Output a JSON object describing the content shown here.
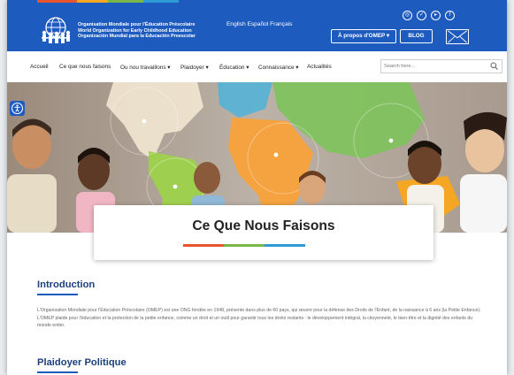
{
  "header": {
    "org_lines": [
      "Organisation Mondiale pour l'Éducation Préscolaire",
      "World Organization for Early Childhood Education",
      "Organización Mundial para la Educación Preescolar"
    ],
    "languages": "English Español Français",
    "about_button": "À propos d'OMEP",
    "blog_button": "BLOG",
    "stripe_colors": [
      "#e8542d",
      "#f5a623",
      "#7ab648",
      "#2e9ad6"
    ]
  },
  "nav": {
    "items": [
      "Accueil",
      "Ce que nous faisons",
      "Ou nou travaillons",
      "Plaidoyer",
      "Éducation",
      "Connaissance",
      "Actualités"
    ],
    "dropdown_mark": "▾",
    "search_placeholder": "Search here..."
  },
  "hero": {
    "title": "Ce Que Nous Faisons",
    "title_bar_colors": [
      "#e8542d",
      "#7ab648",
      "#2e9ad6"
    ]
  },
  "content": {
    "intro_heading": "Introduction",
    "intro_text": "L'Organisation Mondiale pour l'Éducation Préscolaire (OMEP) est une ONG fondée en 1948, présente dans plus de 60 pays, qui œuvre pour la défense des Droits de l'Enfant, de la naissance à 6 ans (la Petite Enfance). L'OMEP plaide pour l'éducation et la protection de la petite enfance, comme un droit et un outil pour garantir tous les droits restants : le développement intégral, la citoyenneté, le bien-être et la dignité des enfants du monde entier.",
    "advocacy_heading": "Plaidoyer Politique"
  },
  "colors": {
    "primary_blue": "#1e5bbf",
    "heading_blue": "#1d3f7e"
  }
}
